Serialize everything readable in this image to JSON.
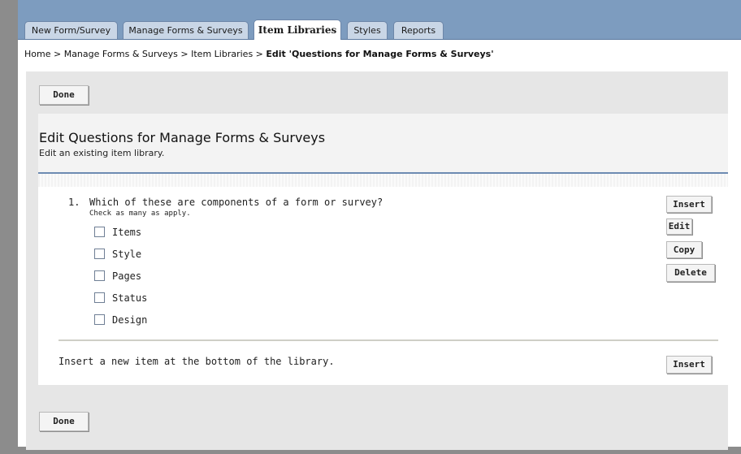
{
  "tabs": [
    {
      "label": "New Form/Survey",
      "active": false
    },
    {
      "label": "Manage Forms & Surveys",
      "active": false
    },
    {
      "label": "Item Libraries",
      "active": true
    },
    {
      "label": "Styles",
      "active": false
    },
    {
      "label": "Reports",
      "active": false
    }
  ],
  "breadcrumb": {
    "home": "Home",
    "sep": ">",
    "manage": "Manage Forms & Surveys",
    "libraries": "Item Libraries",
    "current": "Edit 'Questions for Manage Forms & Surveys'"
  },
  "toolbar": {
    "done_label": "Done"
  },
  "header": {
    "title": "Edit Questions for Manage Forms & Surveys",
    "subtitle": "Edit an existing item library."
  },
  "question": {
    "number": "1.",
    "text": "Which of these are components of a form or survey?",
    "hint": "Check as many as apply.",
    "options": [
      "Items",
      "Style",
      "Pages",
      "Status",
      "Design"
    ],
    "actions": {
      "insert": "Insert",
      "edit": "Edit",
      "copy": "Copy",
      "delete": "Delete"
    }
  },
  "footer": {
    "note": "Insert a new item at the bottom of the library.",
    "insert_label": "Insert",
    "done_label": "Done"
  },
  "colors": {
    "tab_bar": "#7d9cbf",
    "panel": "#e6e6e6",
    "rule": "#6d8bb2"
  }
}
